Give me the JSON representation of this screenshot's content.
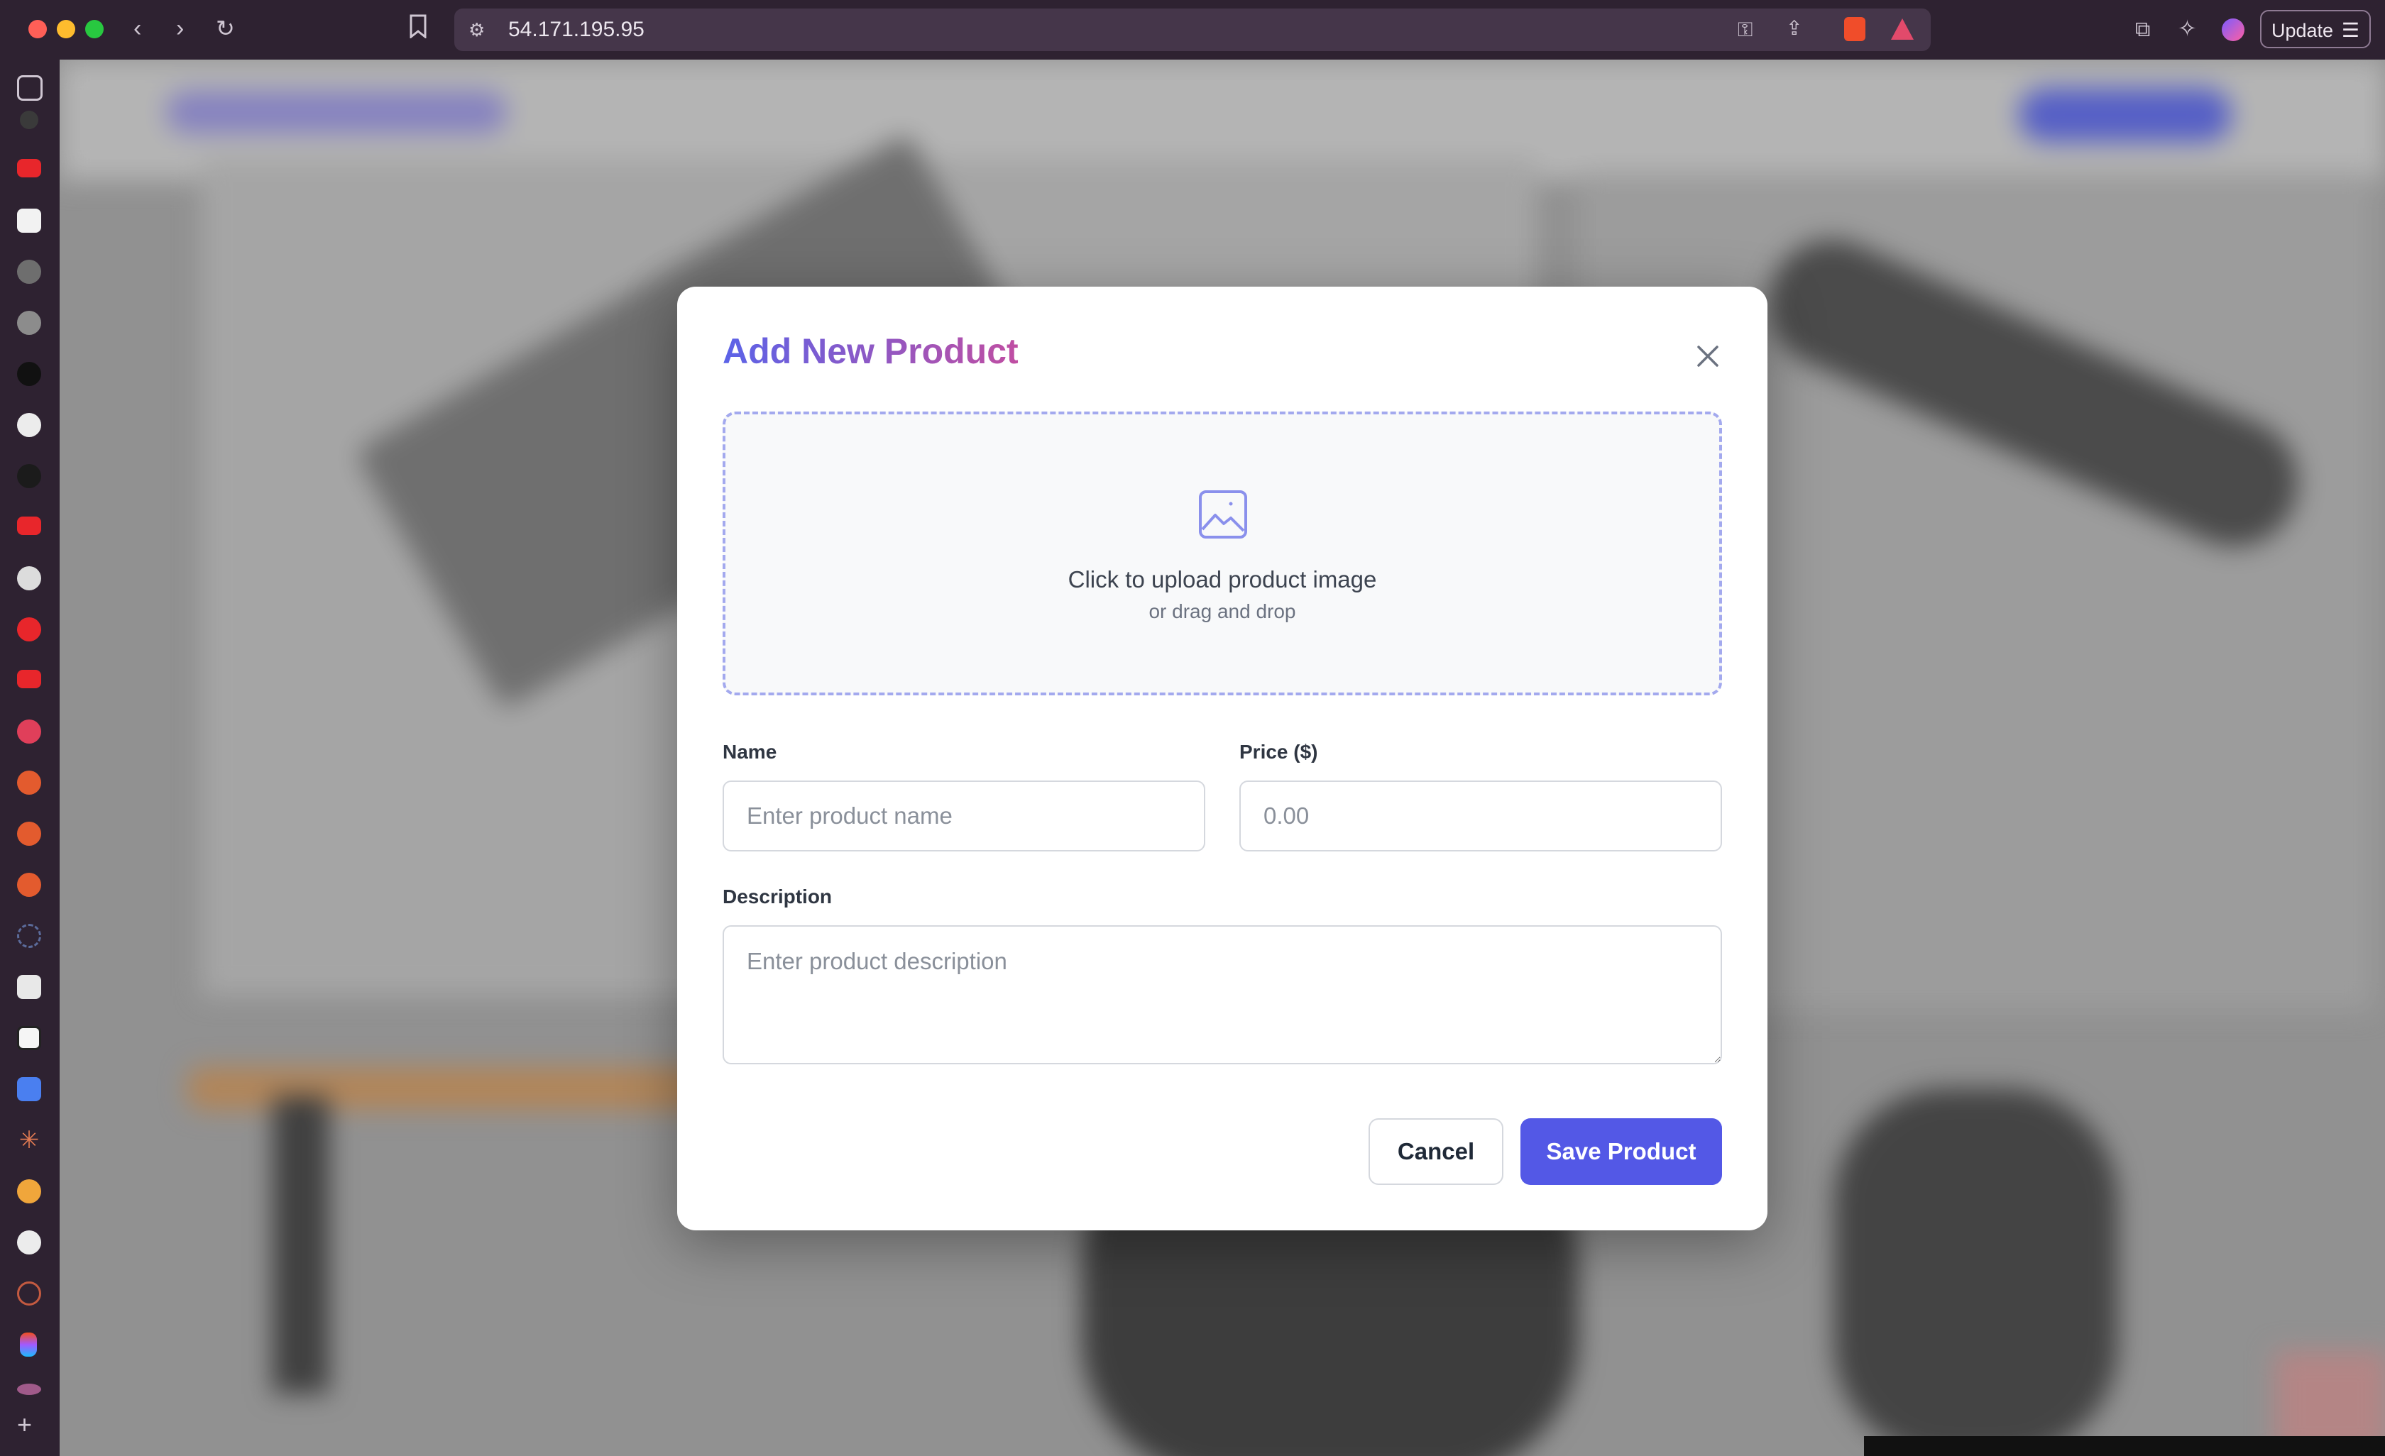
{
  "browser": {
    "url": "54.171.195.95",
    "update_label": "Update"
  },
  "modal": {
    "title": "Add New Product",
    "upload": {
      "title": "Click to upload product image",
      "subtitle": "or drag and drop"
    },
    "fields": {
      "name_label": "Name",
      "name_placeholder": "Enter product name",
      "price_label": "Price ($)",
      "price_placeholder": "0.00",
      "description_label": "Description",
      "description_placeholder": "Enter product description"
    },
    "buttons": {
      "cancel": "Cancel",
      "save": "Save Product"
    }
  },
  "colors": {
    "accent": "#5358e6",
    "title_gradient_start": "#5b63e8",
    "title_gradient_end": "#c04ea2"
  }
}
